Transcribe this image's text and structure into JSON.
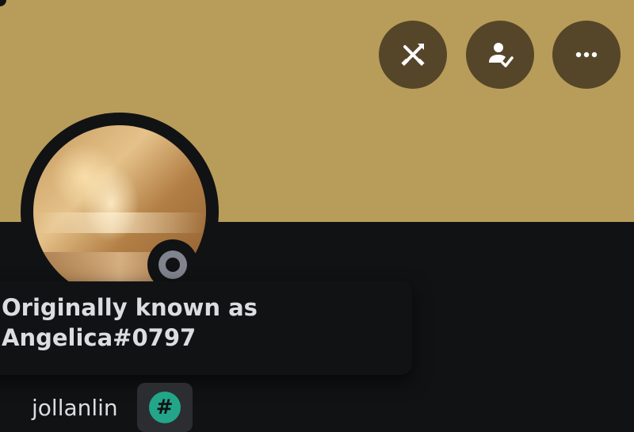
{
  "profile": {
    "username": "jollanlin",
    "previous_name_label": "Originally known as\nAngelica#0797",
    "badge_symbol": "#",
    "status": "offline"
  },
  "actions": [
    {
      "icon": "swords-off-icon"
    },
    {
      "icon": "person-check-icon"
    },
    {
      "icon": "more-icon"
    }
  ],
  "colors": {
    "banner": "#b89c59",
    "action_button": "#55462a",
    "background": "#111214",
    "badge": "#23a58a",
    "status_offline": "#80848e"
  }
}
